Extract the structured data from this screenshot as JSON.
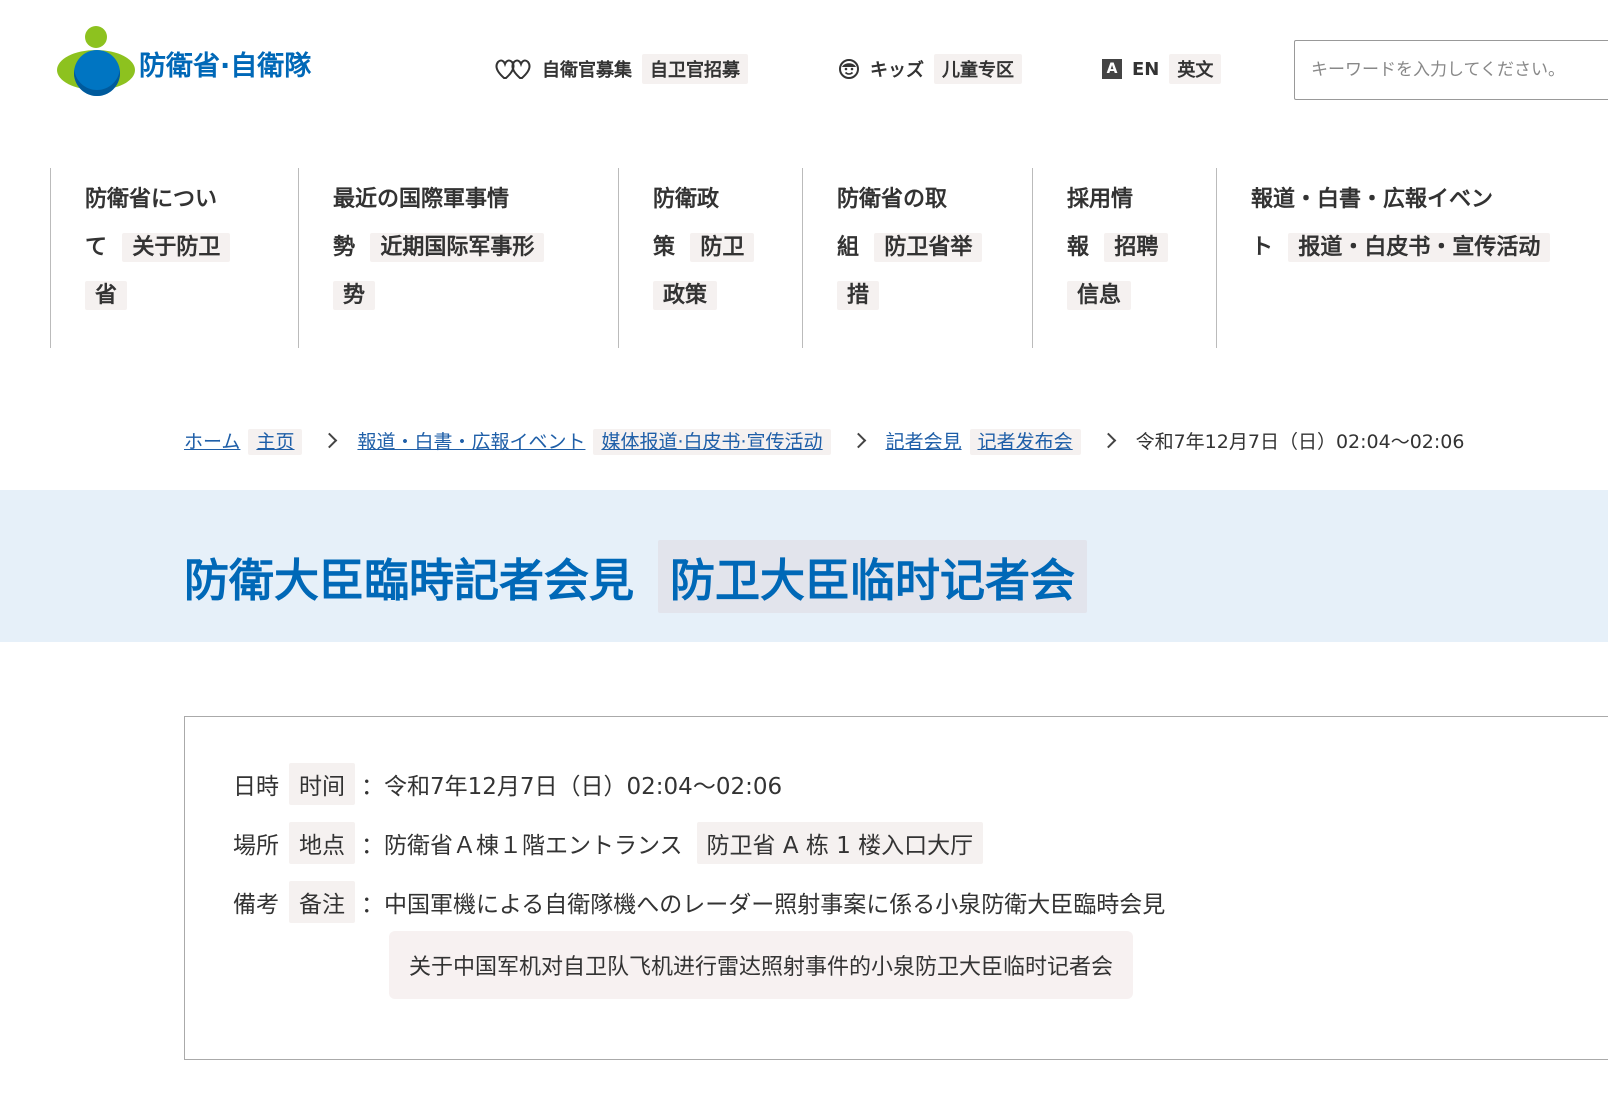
{
  "header": {
    "logo_text": "防衛省·自衛隊",
    "recruit": {
      "label": "自衛官募集",
      "translation": "自卫官招募",
      "icon": "hearts-icon"
    },
    "kids": {
      "label": "キッズ",
      "translation": "儿童专区",
      "icon": "smiley-face-icon"
    },
    "english": {
      "badge": "A",
      "label": "EN",
      "translation": "英文"
    },
    "search": {
      "placeholder": "キーワードを入力してください。",
      "value": ""
    }
  },
  "nav": {
    "items": [
      {
        "line1": "防衛省につい",
        "line2_ja": "て",
        "line2_tr": "关于防卫",
        "line3": "省"
      },
      {
        "line1": "最近の国際軍事情",
        "line2_ja": "勢",
        "line2_tr": "近期国际军事形",
        "line3": "势"
      },
      {
        "line1": "防衛政",
        "line2_ja": "策",
        "line2_tr": "防卫",
        "line3": "政策"
      },
      {
        "line1": "防衛省の取",
        "line2_ja": "組",
        "line2_tr": "防卫省举",
        "line3": "措"
      },
      {
        "line1": "採用情",
        "line2_ja": "報",
        "line2_tr": "招聘",
        "line3": "信息"
      },
      {
        "line1": "報道・白書・広報イベン",
        "line2_ja": "ト",
        "line2_tr": "报道・白皮书・宣传活动",
        "line3": ""
      }
    ]
  },
  "breadcrumb": {
    "home": {
      "label": "ホーム",
      "translation": "主页"
    },
    "press": {
      "label": "報道・白書・広報イベント",
      "translation": "媒体报道·白皮书·宣传活动"
    },
    "conference": {
      "label": "記者会見",
      "translation": "记者发布会"
    },
    "current": "令和7年12月7日（日）02:04〜02:06"
  },
  "page": {
    "title": "防衛大臣臨時記者会見",
    "title_translation": "防卫大臣临时记者会"
  },
  "info": {
    "datetime": {
      "label": "日時",
      "translation": "时间",
      "value": "：令和7年12月7日（日）02:04〜02:06"
    },
    "place": {
      "label": "場所",
      "translation": "地点",
      "value": "：防衛省Ａ棟１階エントランス",
      "value_translation": "防卫省 A 栋 1 楼入口大厅"
    },
    "note": {
      "label": "備考",
      "translation": "备注",
      "value": "：中国軍機による自衛隊機へのレーダー照射事案に係る小泉防衛大臣臨時会見",
      "value_translation": "关于中国军机对自卫队飞机进行雷达照射事件的小泉防卫大臣临时记者会"
    }
  },
  "colors": {
    "brand_blue": "#0068b7",
    "brand_green": "#8dc21f",
    "title_band": "#e6f0f9",
    "link": "#1f5fa8"
  }
}
